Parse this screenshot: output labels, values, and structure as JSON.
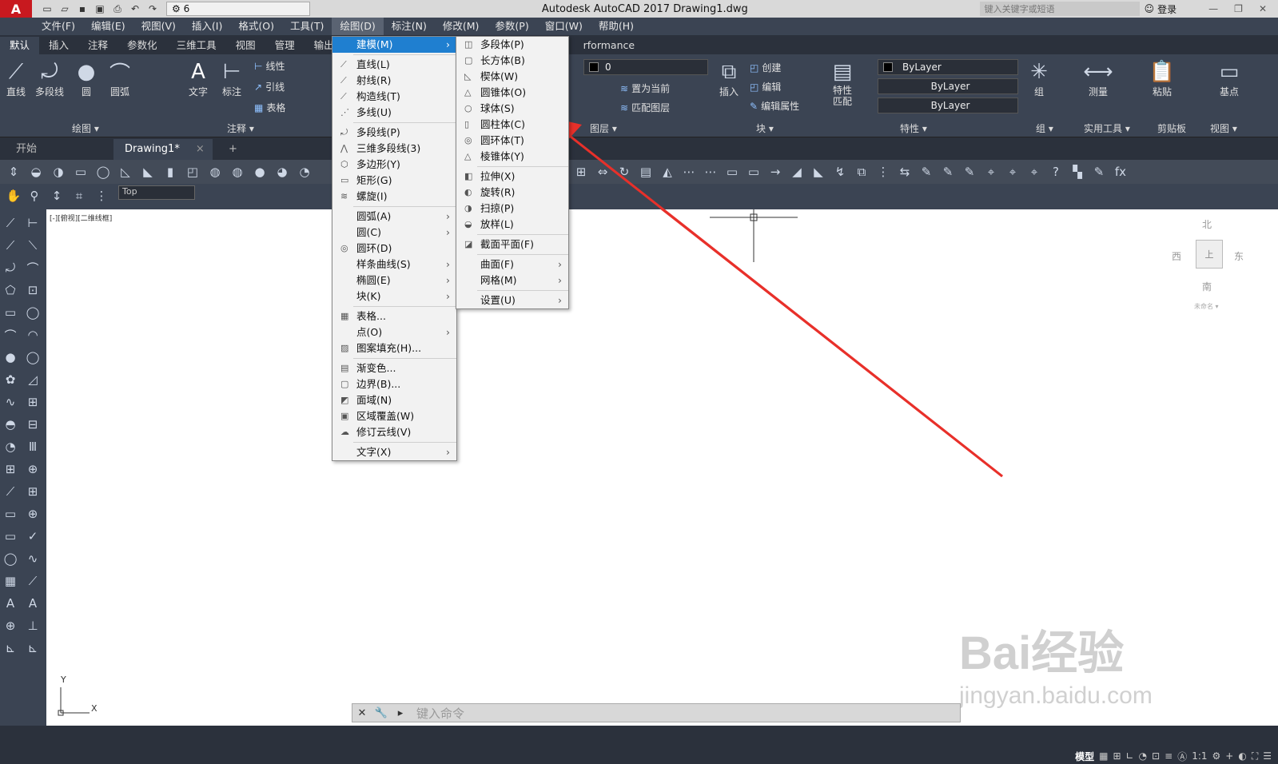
{
  "window": {
    "title": "Autodesk AutoCAD 2017    Drawing1.dwg",
    "workspace": "6",
    "search_placeholder": "键入关键字或短语",
    "login": "登录"
  },
  "menubar": [
    "文件(F)",
    "编辑(E)",
    "视图(V)",
    "插入(I)",
    "格式(O)",
    "工具(T)",
    "绘图(D)",
    "标注(N)",
    "修改(M)",
    "参数(P)",
    "窗口(W)",
    "帮助(H)"
  ],
  "ribbon_tabs": [
    "默认",
    "插入",
    "注释",
    "参数化",
    "三维工具",
    "视图",
    "管理",
    "输出",
    "rformance"
  ],
  "ribbon": {
    "draw": {
      "line": "直线",
      "polyline": "多段线",
      "circle": "圆",
      "arc": "圆弧",
      "panel": "绘图 ▾"
    },
    "annotation": {
      "text": "文字",
      "dimension": "标注",
      "linear": "线性",
      "leader": "引线",
      "table": "表格",
      "panel": "注释 ▾"
    },
    "layers": {
      "layer_value": "0",
      "set_current": "置为当前",
      "match_layer": "匹配图层",
      "panel": "图层 ▾"
    },
    "block": {
      "insert": "插入",
      "create": "创建",
      "edit": "编辑",
      "edit_attr": "编辑属性",
      "panel": "块 ▾"
    },
    "properties": {
      "match": "特性匹配",
      "color": "ByLayer",
      "linetype": "ByLayer",
      "lineweight": "ByLayer",
      "panel": "特性 ▾"
    },
    "groups": {
      "group": "组",
      "panel": "组 ▾"
    },
    "utilities": {
      "measure": "测量",
      "panel": "实用工具 ▾"
    },
    "clipboard": {
      "paste": "粘贴",
      "panel": "剪贴板"
    },
    "view": {
      "base": "基点",
      "panel": "视图 ▾"
    }
  },
  "doc_tabs": {
    "start": "开始",
    "drawing": "Drawing1*",
    "close": "×",
    "add": "+"
  },
  "view_combo": "Top",
  "viewport_label": "[-][俯视][二维线框]",
  "draw_menu": [
    {
      "label": "建模(M)",
      "sub": true,
      "highlight": true
    },
    {
      "sep": true
    },
    {
      "label": "直线(L)",
      "icon": "⟋"
    },
    {
      "label": "射线(R)",
      "icon": "⟋"
    },
    {
      "label": "构造线(T)",
      "icon": "⟋"
    },
    {
      "label": "多线(U)",
      "icon": "⋰"
    },
    {
      "sep": true
    },
    {
      "label": "多段线(P)",
      "icon": "⤾"
    },
    {
      "label": "三维多段线(3)",
      "icon": "⋀"
    },
    {
      "label": "多边形(Y)",
      "icon": "⬡"
    },
    {
      "label": "矩形(G)",
      "icon": "▭"
    },
    {
      "label": "螺旋(I)",
      "icon": "≋"
    },
    {
      "sep": true
    },
    {
      "label": "圆弧(A)",
      "sub": true
    },
    {
      "label": "圆(C)",
      "sub": true
    },
    {
      "label": "圆环(D)",
      "icon": "◎"
    },
    {
      "label": "样条曲线(S)",
      "sub": true
    },
    {
      "label": "椭圆(E)",
      "sub": true
    },
    {
      "label": "块(K)",
      "sub": true
    },
    {
      "sep": true
    },
    {
      "label": "表格...",
      "icon": "▦"
    },
    {
      "label": "点(O)",
      "sub": true
    },
    {
      "label": "图案填充(H)...",
      "icon": "▨"
    },
    {
      "sep": true
    },
    {
      "label": "渐变色...",
      "icon": "▤"
    },
    {
      "label": "边界(B)...",
      "icon": "▢"
    },
    {
      "label": "面域(N)",
      "icon": "◩"
    },
    {
      "label": "区域覆盖(W)",
      "icon": "▣"
    },
    {
      "label": "修订云线(V)",
      "icon": "☁"
    },
    {
      "sep": true
    },
    {
      "label": "文字(X)",
      "sub": true
    }
  ],
  "modeling_menu": [
    {
      "label": "多段体(P)",
      "icon": "◫"
    },
    {
      "label": "长方体(B)",
      "icon": "▢"
    },
    {
      "label": "楔体(W)",
      "icon": "◺"
    },
    {
      "label": "圆锥体(O)",
      "icon": "△"
    },
    {
      "label": "球体(S)",
      "icon": "○"
    },
    {
      "label": "圆柱体(C)",
      "icon": "▯"
    },
    {
      "label": "圆环体(T)",
      "icon": "◎"
    },
    {
      "label": "棱锥体(Y)",
      "icon": "△"
    },
    {
      "sep": true
    },
    {
      "label": "拉伸(X)",
      "icon": "◧"
    },
    {
      "label": "旋转(R)",
      "icon": "◐"
    },
    {
      "label": "扫掠(P)",
      "icon": "◑"
    },
    {
      "label": "放样(L)",
      "icon": "◒"
    },
    {
      "sep": true
    },
    {
      "label": "截面平面(F)",
      "icon": "◪"
    },
    {
      "sep": true
    },
    {
      "label": "曲面(F)",
      "sub": true
    },
    {
      "label": "网格(M)",
      "sub": true
    },
    {
      "sep": true
    },
    {
      "label": "设置(U)",
      "sub": true
    }
  ],
  "viewcube": {
    "north": "北",
    "south": "南",
    "east": "东",
    "west": "西",
    "top": "上",
    "wcs": "未命名 ▾"
  },
  "ucs": {
    "x": "X",
    "y": "Y"
  },
  "command_line": {
    "placeholder": "键入命令"
  },
  "status_bar": {
    "model": "模型",
    "scale": "1:1"
  },
  "watermark": {
    "brand": "Bai经验",
    "url": "jingyan.baidu.com"
  },
  "colors": {
    "arrow": "#e8302a",
    "highlight": "#1f7fd0",
    "ribbon": "#3b4453"
  }
}
